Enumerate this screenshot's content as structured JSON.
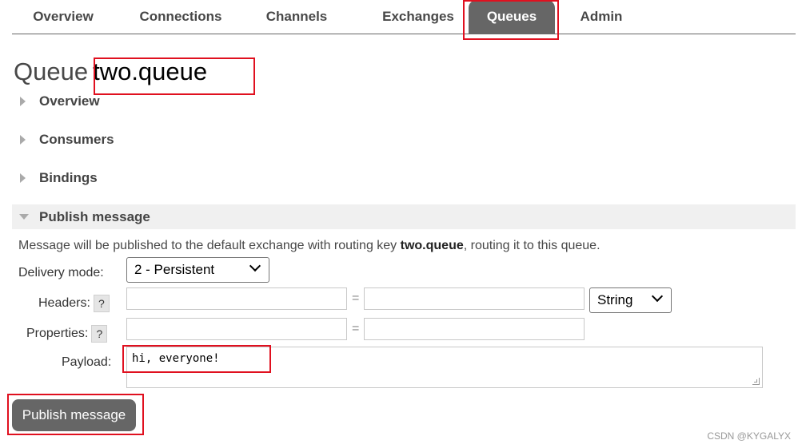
{
  "nav": {
    "tabs": [
      {
        "label": "Overview"
      },
      {
        "label": "Connections"
      },
      {
        "label": "Channels"
      },
      {
        "label": "Exchanges"
      },
      {
        "label": "Queues"
      },
      {
        "label": "Admin"
      }
    ],
    "active": "Queues"
  },
  "page": {
    "title_prefix": "Queue",
    "queue_name": "two.queue"
  },
  "sections": {
    "overview": "Overview",
    "consumers": "Consumers",
    "bindings": "Bindings",
    "publish": "Publish message"
  },
  "publish": {
    "info_before": "Message will be published to the default exchange with routing key ",
    "routing_key": "two.queue",
    "info_after": ", routing it to this queue.",
    "delivery_mode_label": "Delivery mode:",
    "delivery_mode_value": "2 - Persistent",
    "headers_label": "Headers:",
    "properties_label": "Properties:",
    "help_glyph": "?",
    "equals": "=",
    "header_type_value": "String",
    "payload_label": "Payload:",
    "payload_value": "hi, everyone!",
    "button_label": "Publish message"
  },
  "watermark": "CSDN @KYGALYX",
  "colors": {
    "active_tab": "#666666",
    "highlight": "#e0101f",
    "button": "#666666"
  }
}
